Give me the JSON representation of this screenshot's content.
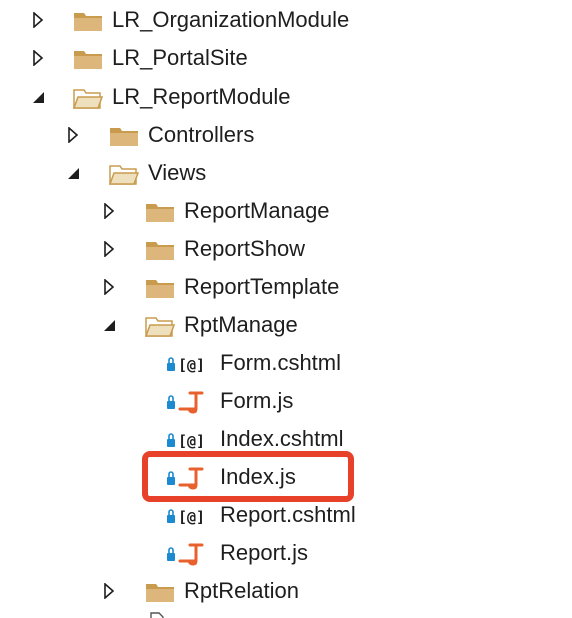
{
  "tree": {
    "nodes": [
      {
        "label": "LR_OrganizationModule",
        "kind": "folder",
        "state": "collapsed"
      },
      {
        "label": "LR_PortalSite",
        "kind": "folder",
        "state": "collapsed"
      },
      {
        "label": "LR_ReportModule",
        "kind": "folder",
        "state": "expanded"
      },
      {
        "label": "Controllers",
        "kind": "folder",
        "state": "collapsed"
      },
      {
        "label": "Views",
        "kind": "folder",
        "state": "expanded"
      },
      {
        "label": "ReportManage",
        "kind": "folder",
        "state": "collapsed"
      },
      {
        "label": "ReportShow",
        "kind": "folder",
        "state": "collapsed"
      },
      {
        "label": "ReportTemplate",
        "kind": "folder",
        "state": "collapsed"
      },
      {
        "label": "RptManage",
        "kind": "folder",
        "state": "expanded"
      },
      {
        "label": "Form.cshtml",
        "kind": "cshtml-file",
        "icon": "razor-file-icon"
      },
      {
        "label": "Form.js",
        "kind": "js-file",
        "icon": "js-file-icon"
      },
      {
        "label": "Index.cshtml",
        "kind": "cshtml-file",
        "icon": "razor-file-icon"
      },
      {
        "label": "Index.js",
        "kind": "js-file",
        "icon": "js-file-icon",
        "highlighted": true
      },
      {
        "label": "Report.cshtml",
        "kind": "cshtml-file",
        "icon": "razor-file-icon"
      },
      {
        "label": "Report.js",
        "kind": "js-file",
        "icon": "js-file-icon"
      },
      {
        "label": "RptRelation",
        "kind": "folder",
        "state": "collapsed"
      }
    ]
  },
  "colors": {
    "folder": "#dcb67a",
    "folder_dark": "#c89b4f",
    "js_icon": "#e8602c",
    "lock_icon": "#1b8ad0",
    "highlight_border": "#e8412a",
    "text": "#1e1e1e"
  }
}
